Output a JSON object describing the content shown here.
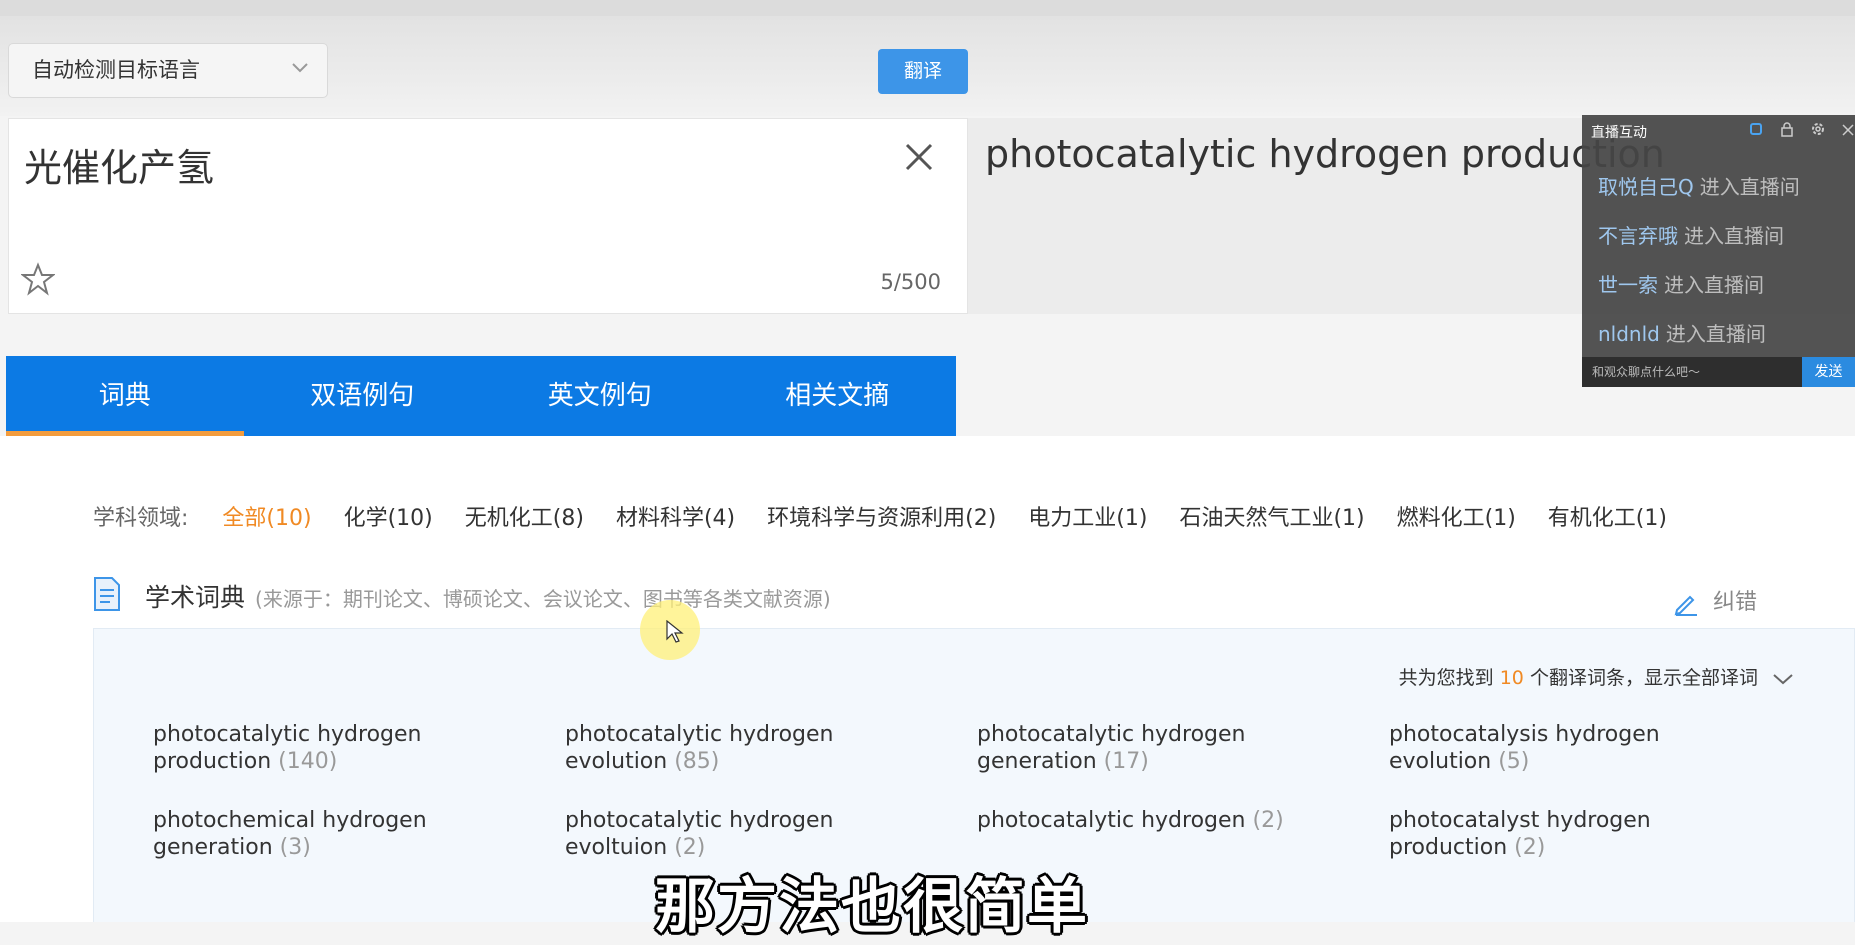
{
  "header": {
    "lang_select": "自动检测目标语言",
    "translate_button": "翻译"
  },
  "source": {
    "text": "光催化产氢",
    "counter": "5/500"
  },
  "target": {
    "text": "photocatalytic hydrogen production"
  },
  "tabs": [
    "词典",
    "双语例句",
    "英文例句",
    "相关文摘"
  ],
  "fields": {
    "label": "学科领域:",
    "items": [
      "全部(10)",
      "化学(10)",
      "无机化工(8)",
      "材料科学(4)",
      "环境科学与资源利用(2)",
      "电力工业(1)",
      "石油天然气工业(1)",
      "燃料化工(1)",
      "有机化工(1)"
    ]
  },
  "dict": {
    "title": "学术词典",
    "source": "(来源于：期刊论文、博硕论文、会议论文、图书等各类文献资源)",
    "correct": "纠错",
    "found_prefix": "共为您找到",
    "found_count": "10",
    "found_suffix": "个翻译词条，显示全部译词"
  },
  "terms": [
    {
      "text": "photocatalytic hydrogen production",
      "count": "(140)"
    },
    {
      "text": "photocatalytic hydrogen evolution",
      "count": "(85)"
    },
    {
      "text": "photocatalytic hydrogen generation",
      "count": "(17)"
    },
    {
      "text": "photocatalysis hydrogen evolution",
      "count": "(5)"
    },
    {
      "text": "photochemical hydrogen generation",
      "count": "(3)"
    },
    {
      "text": "photocatalytic hydrogen evoltuion",
      "count": "(2)"
    },
    {
      "text": "photocatalytic hydrogen",
      "count": "(2)"
    },
    {
      "text": "photocatalyst hydrogen production",
      "count": "(2)"
    }
  ],
  "live": {
    "title": "直播互动",
    "messages": [
      {
        "user": "取悦自己Q",
        "action": "进入直播间"
      },
      {
        "user": "不言弃哦",
        "action": "进入直播间"
      },
      {
        "user": "世一索",
        "action": "进入直播间"
      },
      {
        "user": "nldnld",
        "action": "进入直播间"
      }
    ],
    "input_placeholder": "和观众聊点什么吧～",
    "send": "发送"
  },
  "subtitle": "那方法也很简单",
  "colors": {
    "brand_blue": "#0c7ae4",
    "accent_orange": "#f08a24"
  }
}
